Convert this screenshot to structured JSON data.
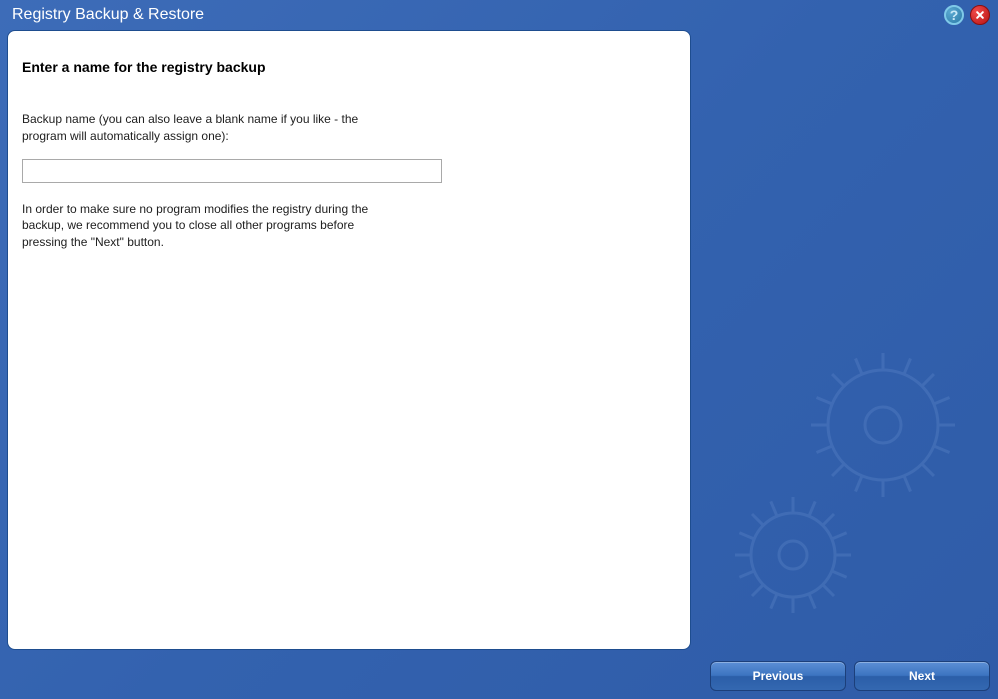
{
  "window": {
    "title": "Registry Backup & Restore"
  },
  "main": {
    "heading": "Enter a name for the registry backup",
    "instruction": "Backup name (you can also leave a blank name if you like - the program will automatically assign one):",
    "backupNameValue": "",
    "warning": "In order to make sure no program modifies the registry during the backup, we recommend you to close all other programs before pressing the \"Next\" button."
  },
  "footer": {
    "previousLabel": "Previous",
    "nextLabel": "Next"
  }
}
